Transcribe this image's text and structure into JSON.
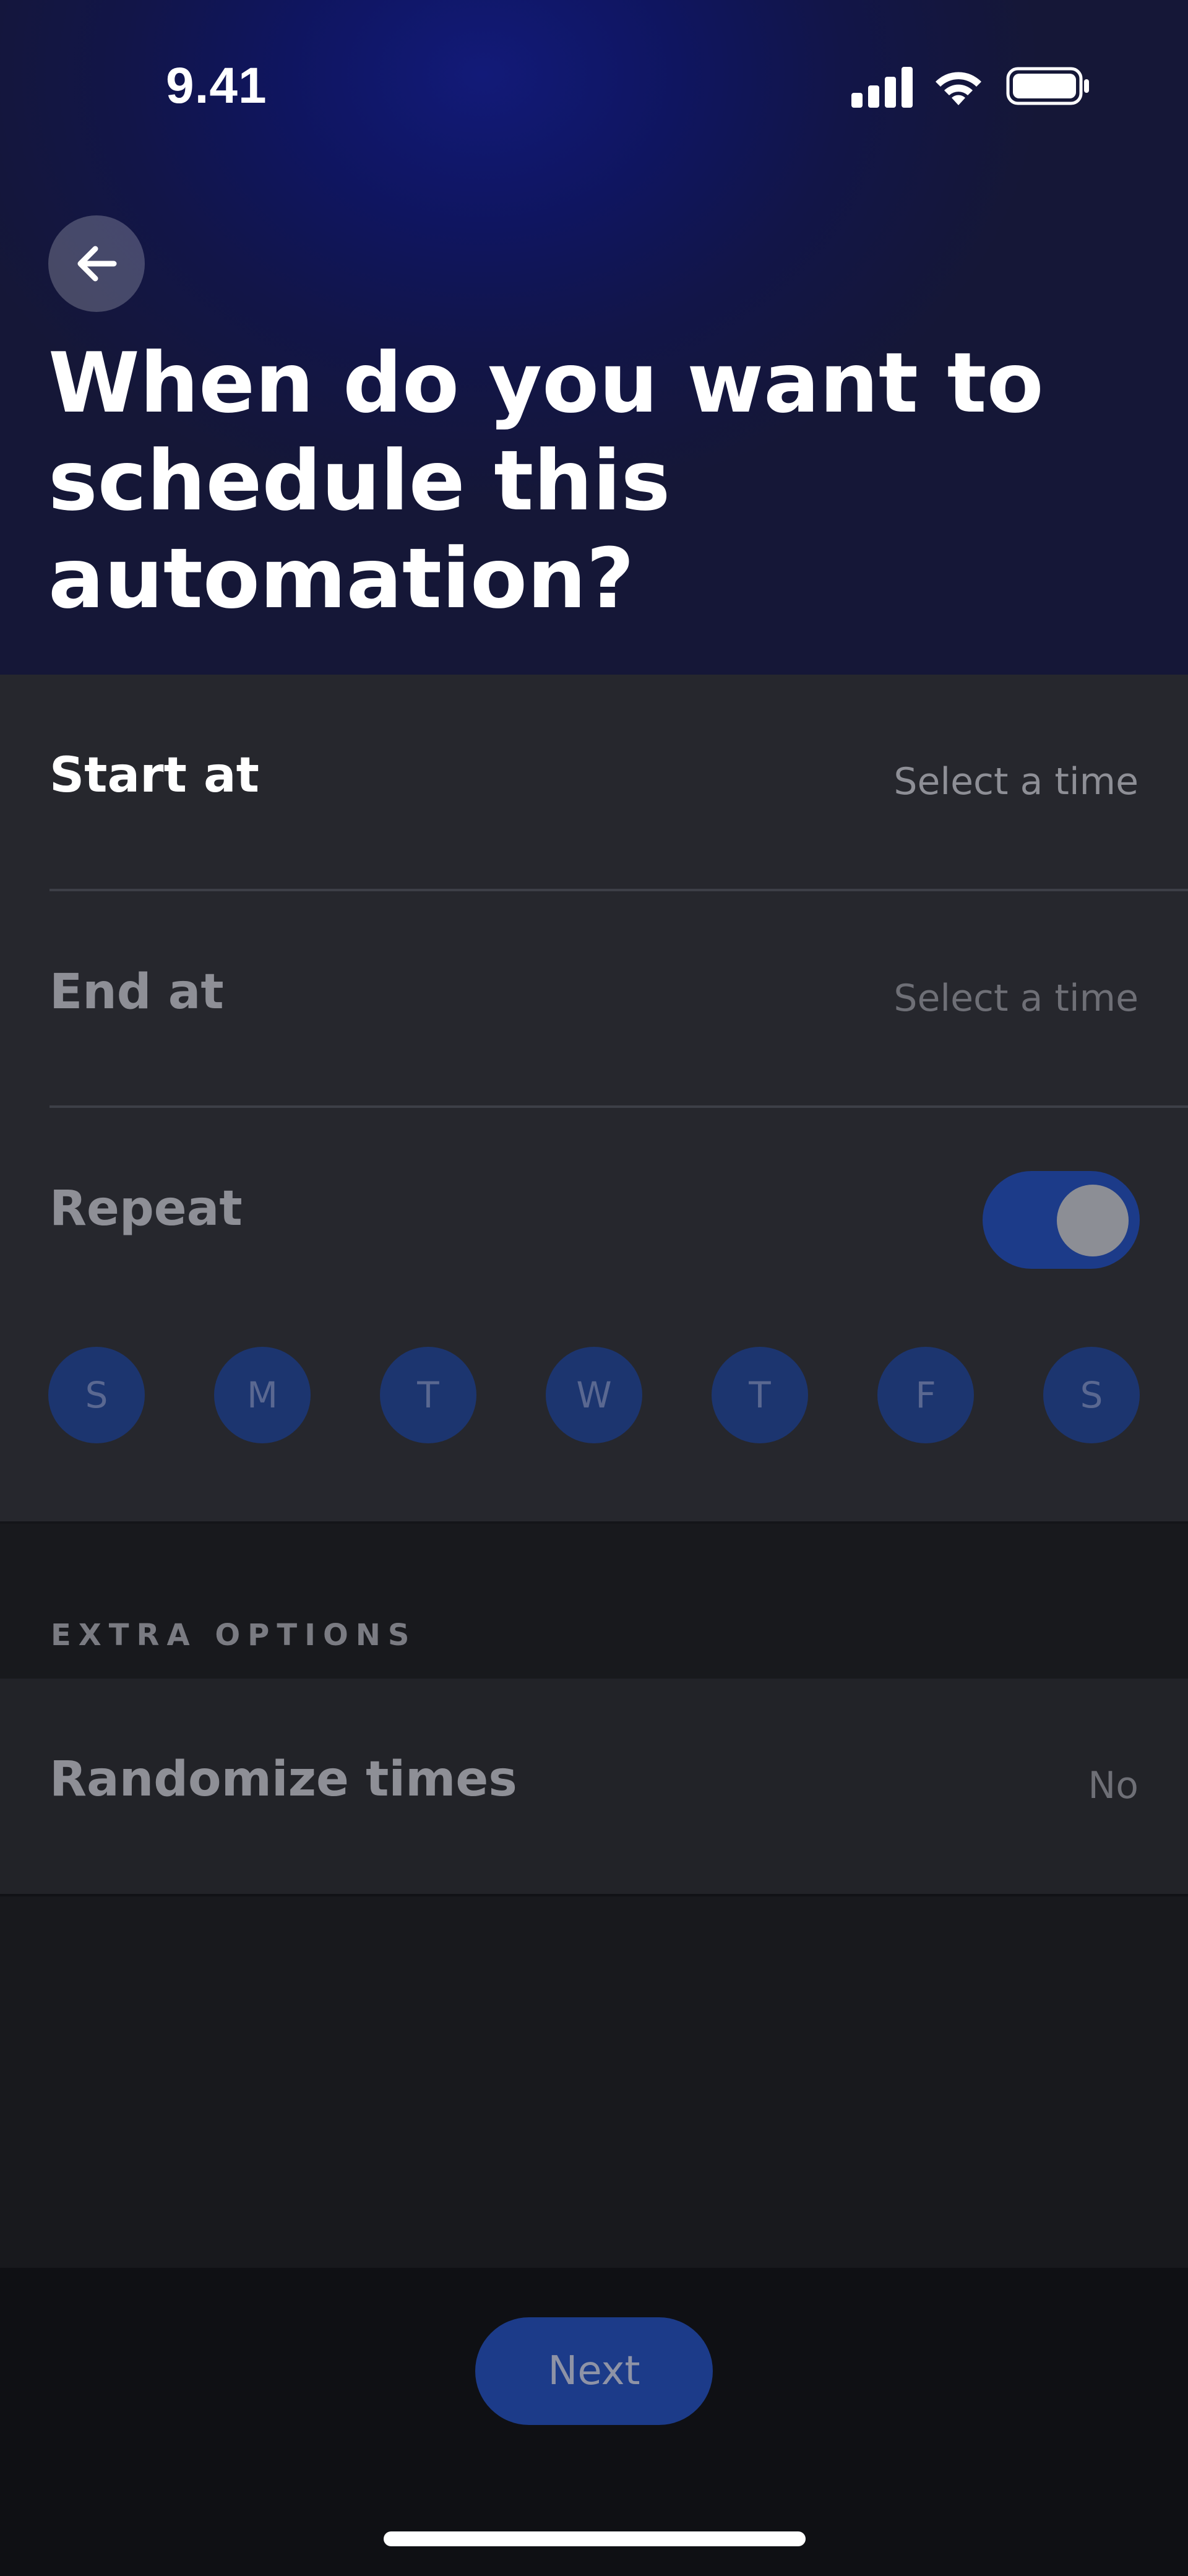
{
  "status_bar": {
    "time": "9.41",
    "icons": [
      "signal-icon",
      "wifi-icon",
      "battery-icon"
    ]
  },
  "header": {
    "back_icon": "arrow-left-icon",
    "title": "When do you want to schedule this automation?"
  },
  "schedule": {
    "start": {
      "label": "Start at",
      "value": "Select a time"
    },
    "end": {
      "label": "End at",
      "value": "Select a time"
    },
    "repeat": {
      "label": "Repeat",
      "enabled": true,
      "days": [
        "S",
        "M",
        "T",
        "W",
        "T",
        "F",
        "S"
      ]
    }
  },
  "extra_options": {
    "header": "EXTRA OPTIONS",
    "randomize": {
      "label": "Randomize times",
      "value": "No"
    }
  },
  "footer": {
    "next_label": "Next"
  },
  "colors": {
    "accent": "#1c3b89",
    "hero": "#121a78",
    "background": "#18191d"
  }
}
